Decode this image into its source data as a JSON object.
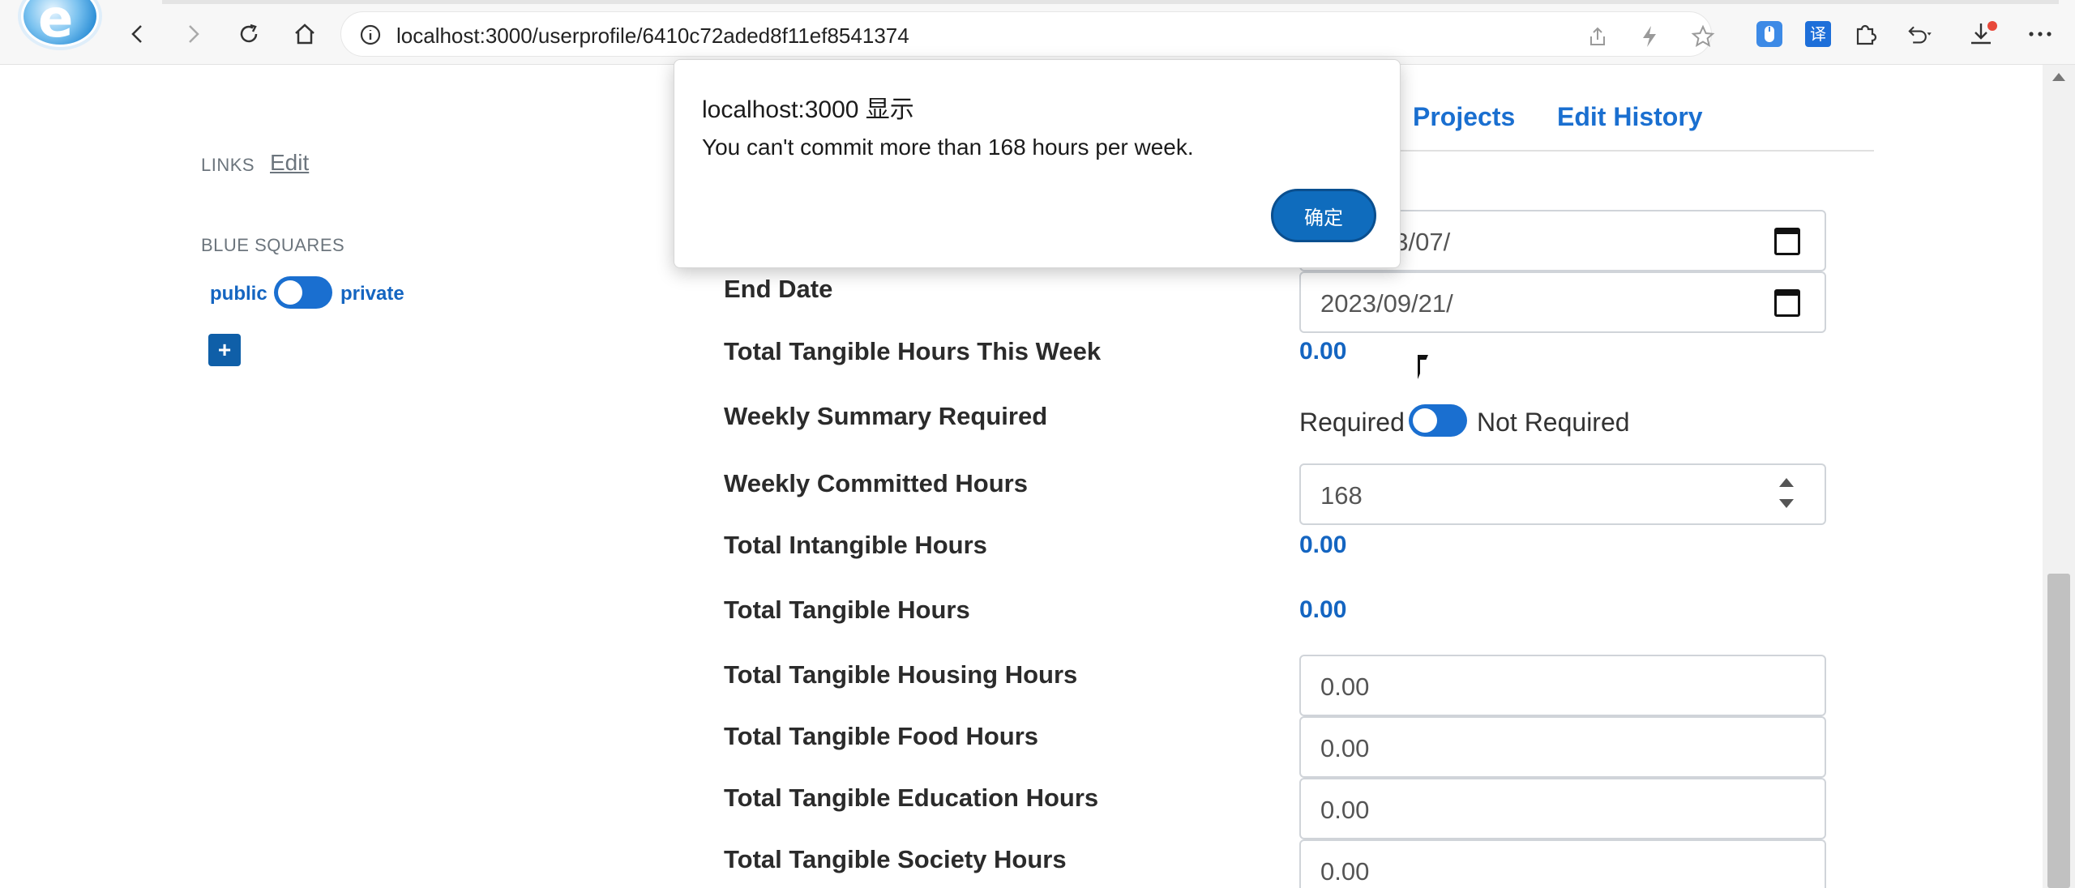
{
  "browser": {
    "url": "localhost:3000/userprofile/6410c72aded8f11ef8541374"
  },
  "sidebar": {
    "links_label": "LINKS",
    "links_edit": "Edit",
    "blue_squares_label": "BLUE SQUARES",
    "public_label": "public",
    "private_label": "private",
    "add_label": "+"
  },
  "tabs": [
    {
      "label": "Projects"
    },
    {
      "label": "Edit History"
    }
  ],
  "form": {
    "start_date_partial": "03/07/",
    "end_date_label": "End Date",
    "end_date_value": "2023/09/21/",
    "tangible_week_label": "Total Tangible Hours This Week",
    "tangible_week_value": "0.00",
    "summary_label": "Weekly Summary Required",
    "summary_required": "Required",
    "summary_not_required": "Not Required",
    "committed_label": "Weekly Committed Hours",
    "committed_value": "168",
    "intangible_label": "Total Intangible Hours",
    "intangible_value": "0.00",
    "tangible_label": "Total Tangible Hours",
    "tangible_value": "0.00",
    "housing_label": "Total Tangible Housing Hours",
    "housing_value": "0.00",
    "food_label": "Total Tangible Food Hours",
    "food_value": "0.00",
    "education_label": "Total Tangible Education Hours",
    "education_value": "0.00",
    "society_label": "Total Tangible Society Hours",
    "society_value": "0.00"
  },
  "dialog": {
    "title": "localhost:3000 显示",
    "message": "You can't commit more than 168 hours per week.",
    "ok_label": "确定"
  },
  "colors": {
    "accent": "#1a6fd0",
    "value_blue": "#1465c1",
    "dialog_button": "#0f6cbd",
    "notification_dot": "#e8493a"
  }
}
